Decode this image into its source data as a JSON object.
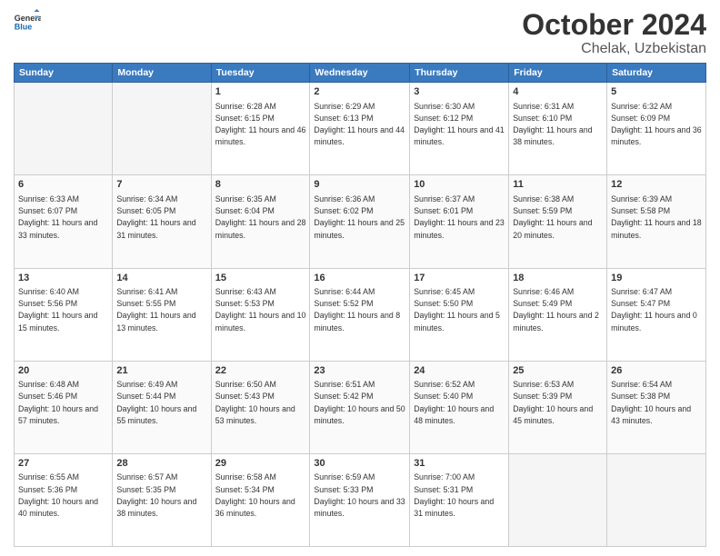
{
  "header": {
    "logo_line1": "General",
    "logo_line2": "Blue",
    "title": "October 2024",
    "location": "Chelak, Uzbekistan"
  },
  "days_of_week": [
    "Sunday",
    "Monday",
    "Tuesday",
    "Wednesday",
    "Thursday",
    "Friday",
    "Saturday"
  ],
  "weeks": [
    [
      {
        "day": "",
        "empty": true
      },
      {
        "day": "",
        "empty": true
      },
      {
        "day": "1",
        "sunrise": "6:28 AM",
        "sunset": "6:15 PM",
        "daylight": "11 hours and 46 minutes."
      },
      {
        "day": "2",
        "sunrise": "6:29 AM",
        "sunset": "6:13 PM",
        "daylight": "11 hours and 44 minutes."
      },
      {
        "day": "3",
        "sunrise": "6:30 AM",
        "sunset": "6:12 PM",
        "daylight": "11 hours and 41 minutes."
      },
      {
        "day": "4",
        "sunrise": "6:31 AM",
        "sunset": "6:10 PM",
        "daylight": "11 hours and 38 minutes."
      },
      {
        "day": "5",
        "sunrise": "6:32 AM",
        "sunset": "6:09 PM",
        "daylight": "11 hours and 36 minutes."
      }
    ],
    [
      {
        "day": "6",
        "sunrise": "6:33 AM",
        "sunset": "6:07 PM",
        "daylight": "11 hours and 33 minutes."
      },
      {
        "day": "7",
        "sunrise": "6:34 AM",
        "sunset": "6:05 PM",
        "daylight": "11 hours and 31 minutes."
      },
      {
        "day": "8",
        "sunrise": "6:35 AM",
        "sunset": "6:04 PM",
        "daylight": "11 hours and 28 minutes."
      },
      {
        "day": "9",
        "sunrise": "6:36 AM",
        "sunset": "6:02 PM",
        "daylight": "11 hours and 25 minutes."
      },
      {
        "day": "10",
        "sunrise": "6:37 AM",
        "sunset": "6:01 PM",
        "daylight": "11 hours and 23 minutes."
      },
      {
        "day": "11",
        "sunrise": "6:38 AM",
        "sunset": "5:59 PM",
        "daylight": "11 hours and 20 minutes."
      },
      {
        "day": "12",
        "sunrise": "6:39 AM",
        "sunset": "5:58 PM",
        "daylight": "11 hours and 18 minutes."
      }
    ],
    [
      {
        "day": "13",
        "sunrise": "6:40 AM",
        "sunset": "5:56 PM",
        "daylight": "11 hours and 15 minutes."
      },
      {
        "day": "14",
        "sunrise": "6:41 AM",
        "sunset": "5:55 PM",
        "daylight": "11 hours and 13 minutes."
      },
      {
        "day": "15",
        "sunrise": "6:43 AM",
        "sunset": "5:53 PM",
        "daylight": "11 hours and 10 minutes."
      },
      {
        "day": "16",
        "sunrise": "6:44 AM",
        "sunset": "5:52 PM",
        "daylight": "11 hours and 8 minutes."
      },
      {
        "day": "17",
        "sunrise": "6:45 AM",
        "sunset": "5:50 PM",
        "daylight": "11 hours and 5 minutes."
      },
      {
        "day": "18",
        "sunrise": "6:46 AM",
        "sunset": "5:49 PM",
        "daylight": "11 hours and 2 minutes."
      },
      {
        "day": "19",
        "sunrise": "6:47 AM",
        "sunset": "5:47 PM",
        "daylight": "11 hours and 0 minutes."
      }
    ],
    [
      {
        "day": "20",
        "sunrise": "6:48 AM",
        "sunset": "5:46 PM",
        "daylight": "10 hours and 57 minutes."
      },
      {
        "day": "21",
        "sunrise": "6:49 AM",
        "sunset": "5:44 PM",
        "daylight": "10 hours and 55 minutes."
      },
      {
        "day": "22",
        "sunrise": "6:50 AM",
        "sunset": "5:43 PM",
        "daylight": "10 hours and 53 minutes."
      },
      {
        "day": "23",
        "sunrise": "6:51 AM",
        "sunset": "5:42 PM",
        "daylight": "10 hours and 50 minutes."
      },
      {
        "day": "24",
        "sunrise": "6:52 AM",
        "sunset": "5:40 PM",
        "daylight": "10 hours and 48 minutes."
      },
      {
        "day": "25",
        "sunrise": "6:53 AM",
        "sunset": "5:39 PM",
        "daylight": "10 hours and 45 minutes."
      },
      {
        "day": "26",
        "sunrise": "6:54 AM",
        "sunset": "5:38 PM",
        "daylight": "10 hours and 43 minutes."
      }
    ],
    [
      {
        "day": "27",
        "sunrise": "6:55 AM",
        "sunset": "5:36 PM",
        "daylight": "10 hours and 40 minutes."
      },
      {
        "day": "28",
        "sunrise": "6:57 AM",
        "sunset": "5:35 PM",
        "daylight": "10 hours and 38 minutes."
      },
      {
        "day": "29",
        "sunrise": "6:58 AM",
        "sunset": "5:34 PM",
        "daylight": "10 hours and 36 minutes."
      },
      {
        "day": "30",
        "sunrise": "6:59 AM",
        "sunset": "5:33 PM",
        "daylight": "10 hours and 33 minutes."
      },
      {
        "day": "31",
        "sunrise": "7:00 AM",
        "sunset": "5:31 PM",
        "daylight": "10 hours and 31 minutes."
      },
      {
        "day": "",
        "empty": true
      },
      {
        "day": "",
        "empty": true
      }
    ]
  ]
}
